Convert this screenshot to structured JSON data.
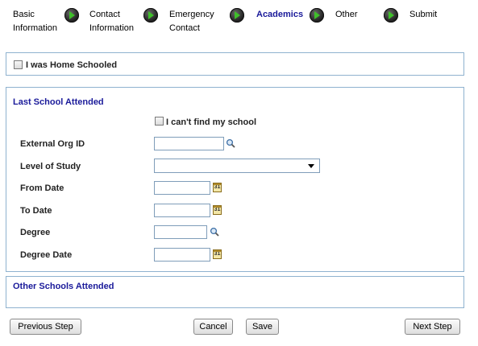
{
  "steps": [
    {
      "label_line1": "Basic",
      "label_line2": "Information",
      "active": false
    },
    {
      "label_line1": "Contact",
      "label_line2": "Information",
      "active": false
    },
    {
      "label_line1": "Emergency",
      "label_line2": "Contact",
      "active": false
    },
    {
      "label_line1": "Academics",
      "label_line2": "",
      "active": true
    },
    {
      "label_line1": "Other",
      "label_line2": "",
      "active": false
    },
    {
      "label_line1": "Submit",
      "label_line2": "",
      "active": false
    }
  ],
  "home_schooled": {
    "label": "I was Home Schooled",
    "checked": false
  },
  "last_school": {
    "title": "Last School Attended",
    "cant_find": {
      "label": "I can't find my school",
      "checked": false
    },
    "fields": {
      "external_org_id": {
        "label": "External Org ID",
        "value": ""
      },
      "level_of_study": {
        "label": "Level of Study",
        "value": ""
      },
      "from_date": {
        "label": "From Date",
        "value": ""
      },
      "to_date": {
        "label": "To Date",
        "value": ""
      },
      "degree": {
        "label": "Degree",
        "value": ""
      },
      "degree_date": {
        "label": "Degree Date",
        "value": ""
      }
    },
    "calendar_glyph": "31"
  },
  "other_schools": {
    "title": "Other Schools Attended"
  },
  "buttons": {
    "previous": "Previous Step",
    "cancel": "Cancel",
    "save": "Save",
    "next": "Next Step"
  },
  "icons": {
    "step_arrow": "green-arrow-icon",
    "lookup": "magnifier-icon",
    "calendar": "calendar-icon"
  },
  "colors": {
    "accent": "#1a1a9a",
    "border": "#8fb2cf",
    "step_arrow_green": "#3fbf2a"
  }
}
